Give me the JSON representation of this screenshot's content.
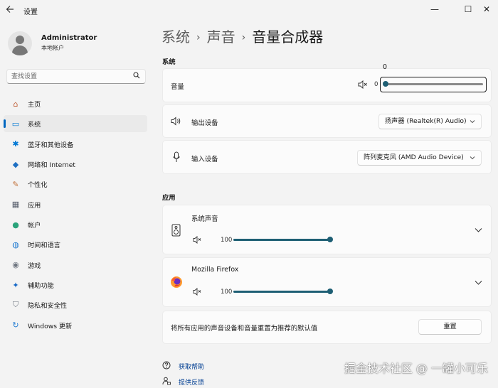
{
  "window": {
    "title": "设置",
    "back_icon": "back-arrow-icon",
    "minimize": "—",
    "maximize": "☐",
    "close": "✕"
  },
  "user": {
    "name": "Administrator",
    "account_type": "本地帐户"
  },
  "search": {
    "placeholder": "查找设置",
    "icon": "search-icon"
  },
  "nav": {
    "items": [
      {
        "label": "主页",
        "icon": "home-icon",
        "glyph": "⌂",
        "color": "#c0613a"
      },
      {
        "label": "系统",
        "icon": "system-icon",
        "glyph": "▭",
        "color": "#0078d4",
        "active": true
      },
      {
        "label": "蓝牙和其他设备",
        "icon": "bluetooth-icon",
        "glyph": "✱",
        "color": "#0078d4"
      },
      {
        "label": "网络和 Internet",
        "icon": "wifi-icon",
        "glyph": "◆",
        "color": "#1d6fc2"
      },
      {
        "label": "个性化",
        "icon": "brush-icon",
        "glyph": "✎",
        "color": "#c2723b"
      },
      {
        "label": "应用",
        "icon": "apps-icon",
        "glyph": "▦",
        "color": "#555c6a"
      },
      {
        "label": "帐户",
        "icon": "account-icon",
        "glyph": "●",
        "color": "#2aa37a"
      },
      {
        "label": "时间和语言",
        "icon": "globe-icon",
        "glyph": "◍",
        "color": "#1f7ad1"
      },
      {
        "label": "游戏",
        "icon": "gamepad-icon",
        "glyph": "◉",
        "color": "#6f7680"
      },
      {
        "label": "辅助功能",
        "icon": "accessibility-icon",
        "glyph": "✦",
        "color": "#1668c7"
      },
      {
        "label": "隐私和安全性",
        "icon": "shield-icon",
        "glyph": "⛉",
        "color": "#6f7680"
      },
      {
        "label": "Windows 更新",
        "icon": "windows-update-icon",
        "glyph": "↻",
        "color": "#1f7ad1"
      }
    ]
  },
  "breadcrumb": {
    "level1": "系统",
    "level2": "声音",
    "current": "音量合成器",
    "sep": "›"
  },
  "system_section": {
    "title": "系统",
    "volume": {
      "label": "音量",
      "value": "0",
      "tooltip": "0",
      "level": 0,
      "mute_icon": "speaker-muted-icon"
    },
    "output": {
      "label": "输出设备",
      "value": "扬声器 (Realtek(R) Audio)",
      "icon": "speaker-icon"
    },
    "input": {
      "label": "输入设备",
      "value": "阵列麦克风 (AMD Audio Device)",
      "icon": "microphone-icon"
    }
  },
  "apps_section": {
    "title": "应用",
    "apps": [
      {
        "name": "系统声音",
        "value": "100",
        "level": 1.0,
        "icon": "system-sounds-icon"
      },
      {
        "name": "Mozilla Firefox",
        "value": "100",
        "level": 1.0,
        "icon": "firefox-icon"
      }
    ],
    "reset": {
      "text": "将所有应用的声音设备和音量重置为推荐的默认值",
      "button": "重置"
    }
  },
  "footer": {
    "help": "获取帮助",
    "feedback": "提供反馈"
  },
  "watermark": "掘金技术社区 @ 一罐小可乐",
  "colors": {
    "accent": "#005fb8",
    "background": "#f3f3f3",
    "card": "#fbfbfb"
  }
}
